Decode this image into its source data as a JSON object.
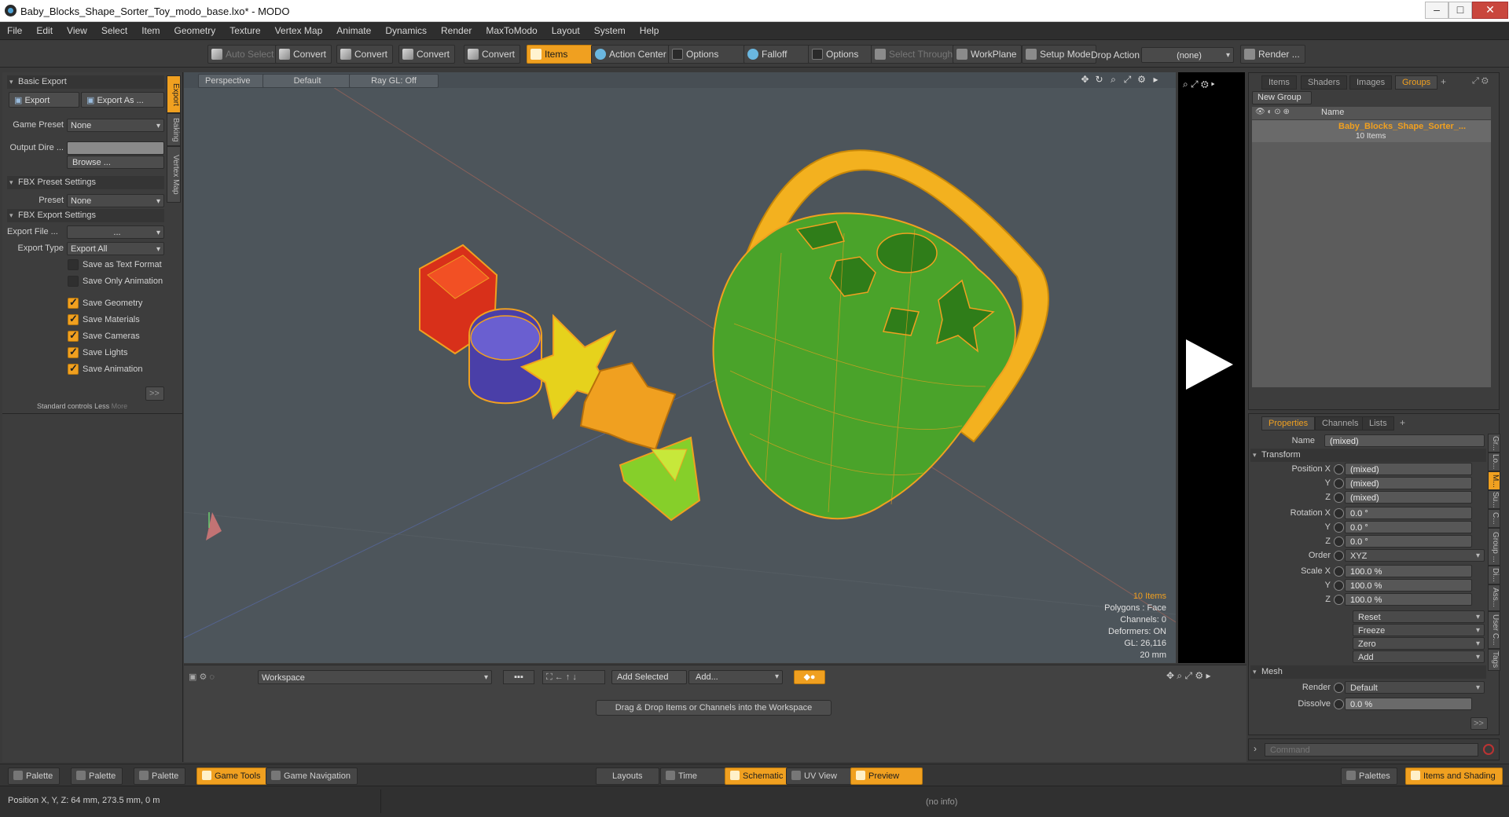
{
  "window": {
    "title": "Baby_Blocks_Shape_Sorter_Toy_modo_base.lxo* - MODO"
  },
  "menu": [
    "File",
    "Edit",
    "View",
    "Select",
    "Item",
    "Geometry",
    "Texture",
    "Vertex Map",
    "Animate",
    "Dynamics",
    "Render",
    "MaxToModo",
    "Layout",
    "System",
    "Help"
  ],
  "toolbar": {
    "auto_select": "Auto Select",
    "convert": "Convert",
    "items": "Items",
    "action_center": "Action Center",
    "options": "Options",
    "falloff": "Falloff",
    "select_through": "Select Through",
    "workplane": "WorkPlane",
    "setup_mode": "Setup Mode",
    "drop_action_label": "Drop Action",
    "drop_action_value": "(none)",
    "render": "Render ..."
  },
  "left_panel": {
    "tabs": [
      "Export",
      "Baking",
      "Vertex Map"
    ],
    "basic_export": "Basic Export",
    "export_btn": "Export",
    "export_as_btn": "Export As ...",
    "game_preset_label": "Game Preset",
    "game_preset_value": "None",
    "output_dir_label": "Output Dire ...",
    "browse_btn": "Browse ...",
    "fbx_preset_settings": "FBX Preset Settings",
    "preset_label": "Preset",
    "preset_value": "None",
    "fbx_export_settings": "FBX Export Settings",
    "export_file_label": "Export File ...",
    "export_file_value": "...",
    "export_type_label": "Export Type",
    "export_type_value": "Export All",
    "checks": [
      {
        "label": "Save as Text Format",
        "on": false
      },
      {
        "label": "Save Only Animation",
        "on": false
      },
      {
        "label": "Save Geometry",
        "on": true
      },
      {
        "label": "Save Materials",
        "on": true
      },
      {
        "label": "Save Cameras",
        "on": true
      },
      {
        "label": "Save Lights",
        "on": true
      },
      {
        "label": "Save Animation",
        "on": true
      }
    ],
    "more_btn": ">>",
    "standard_controls": "Standard controls",
    "less": "Less",
    "more": "More"
  },
  "viewport": {
    "view": "Perspective",
    "shading": "Default",
    "raygl": "Ray GL: Off",
    "info": {
      "items": "10 Items",
      "polygons": "Polygons : Face",
      "channels": "Channels: 0",
      "deformers": "Deformers: ON",
      "gl": "GL: 26,116",
      "scale": "20 mm"
    }
  },
  "items_panel": {
    "tabs": [
      "Items",
      "Shaders",
      "Images",
      "Groups"
    ],
    "new_group": "New Group",
    "name_header": "Name",
    "group_name": "Baby_Blocks_Shape_Sorter_...",
    "group_count": "10 Items"
  },
  "properties": {
    "tabs": [
      "Properties",
      "Channels",
      "Lists"
    ],
    "name_label": "Name",
    "name_value": "(mixed)",
    "transform": "Transform",
    "position_x_label": "Position X",
    "y_label": "Y",
    "z_label": "Z",
    "pos_x": "(mixed)",
    "pos_y": "(mixed)",
    "pos_z": "(mixed)",
    "rotation_x_label": "Rotation X",
    "rot_x": "0.0 °",
    "rot_y": "0.0 °",
    "rot_z": "0.0 °",
    "order_label": "Order",
    "order_value": "XYZ",
    "scale_x_label": "Scale X",
    "scale_x": "100.0 %",
    "scale_y": "100.0 %",
    "scale_z": "100.0 %",
    "reset": "Reset",
    "freeze": "Freeze",
    "zero": "Zero",
    "add": "Add",
    "mesh": "Mesh",
    "render_label": "Render",
    "render_value": "Default",
    "dissolve_label": "Dissolve",
    "dissolve_value": "0.0 %",
    "more_btn": ">>",
    "command_placeholder": "Command",
    "side_tabs": [
      "Gr...",
      "Lo...",
      "M...",
      "Su...",
      "C...",
      "Group ...",
      "Di...",
      "Ass...",
      "User C...",
      "Tags"
    ]
  },
  "workspace": {
    "dropdown": "Workspace",
    "add_selected": "Add Selected",
    "add": "Add...",
    "hint": "Drag & Drop Items or Channels into the Workspace"
  },
  "bottom_tabs": {
    "palette": "Palette",
    "game_tools": "Game Tools",
    "game_navigation": "Game Navigation",
    "layouts": "Layouts",
    "time": "Time",
    "schematic": "Schematic",
    "uv_view": "UV View",
    "preview": "Preview",
    "palettes": "Palettes",
    "items_and_shading": "Items and Shading"
  },
  "status": {
    "position": "Position X, Y, Z:  64 mm, 273.5 mm, 0 m",
    "info": "(no info)"
  },
  "colors": {
    "accent": "#f0a020",
    "viewport_bg": "#4d555b",
    "basket_green": "#4aa32a"
  }
}
